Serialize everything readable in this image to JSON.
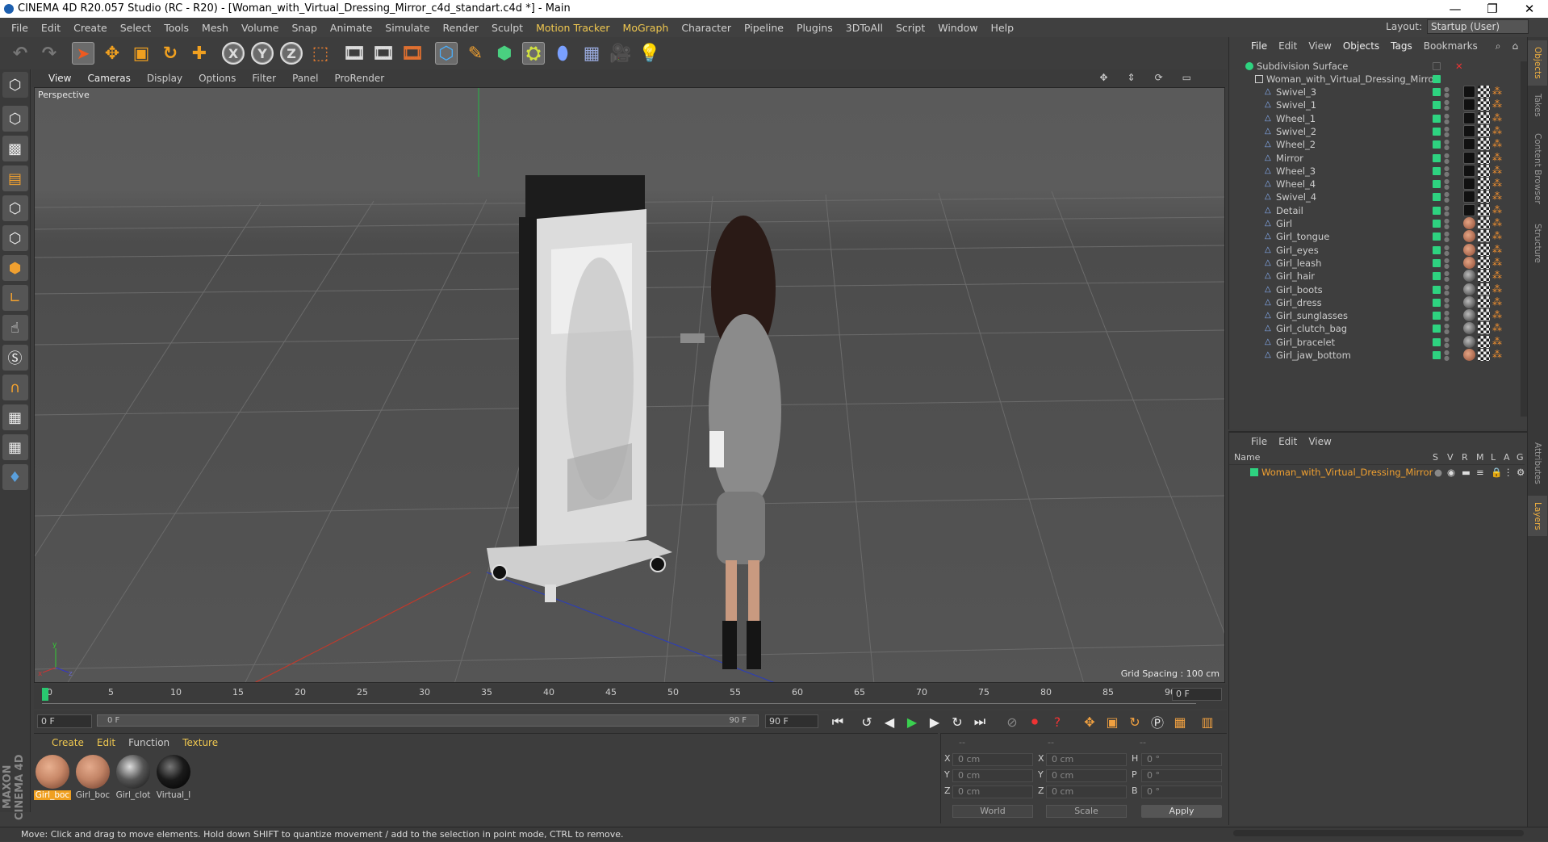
{
  "titlebar": {
    "title": "CINEMA 4D R20.057 Studio (RC - R20) - [Woman_with_Virtual_Dressing_Mirror_c4d_standart.c4d *] - Main",
    "minimize": "—",
    "maximize": "❐",
    "close": "✕"
  },
  "menubar": {
    "items": [
      "File",
      "Edit",
      "Create",
      "Select",
      "Tools",
      "Mesh",
      "Volume",
      "Snap",
      "Animate",
      "Simulate",
      "Render",
      "Sculpt",
      "Motion Tracker",
      "MoGraph",
      "Character",
      "Pipeline",
      "Plugins",
      "3DToAll",
      "Script",
      "Window",
      "Help"
    ],
    "layout_label": "Layout:",
    "layout_value": "Startup (User)"
  },
  "toolbar": {
    "icons": [
      "undo-icon",
      "redo-icon",
      "select-icon",
      "move-icon",
      "scale-icon",
      "rotate-icon",
      "add-icon",
      "x-axis-icon",
      "y-axis-icon",
      "z-axis-icon",
      "coord-system-icon",
      "render-view-icon",
      "render-icon",
      "render-settings-icon",
      "cube-icon",
      "pen-icon",
      "subdivision-icon",
      "cloner-icon",
      "deformer-icon",
      "floor-icon",
      "camera-icon",
      "light-icon"
    ],
    "axis_x": "X",
    "axis_y": "Y",
    "axis_z": "Z"
  },
  "viewport": {
    "menu": [
      "View",
      "Cameras",
      "Display",
      "Options",
      "Filter",
      "Panel",
      "ProRender"
    ],
    "label": "Perspective",
    "grid_spacing": "Grid Spacing : 100 cm",
    "nav_icons": [
      "move-view-icon",
      "zoom-view-icon",
      "rotate-view-icon",
      "maximize-view-icon"
    ],
    "axis_gizmo": {
      "x": "x",
      "y": "y",
      "z": "z"
    }
  },
  "timeline": {
    "ticks": [
      "0",
      "5",
      "10",
      "15",
      "20",
      "25",
      "30",
      "35",
      "40",
      "45",
      "50",
      "55",
      "60",
      "65",
      "70",
      "75",
      "80",
      "85",
      "90"
    ],
    "current_frame": 0,
    "end_field": "0 F",
    "start_field": "0 F",
    "range_start": "0 F",
    "range_end": "90 F",
    "max_field": "90 F"
  },
  "materials": {
    "menu": [
      "Create",
      "Edit",
      "Function",
      "Texture"
    ],
    "items": [
      {
        "name": "Girl_boc",
        "color": "#c88868",
        "selected": true
      },
      {
        "name": "Girl_boc",
        "color": "#c28466",
        "selected": false
      },
      {
        "name": "Girl_clot",
        "color": "#555555",
        "selected": false
      },
      {
        "name": "Virtual_l",
        "color": "#1a1a1a",
        "selected": false
      }
    ]
  },
  "coordinates": {
    "header": [
      "--",
      "--",
      "--"
    ],
    "rows": [
      {
        "a": "X",
        "av": "0 cm",
        "b": "X",
        "bv": "0 cm",
        "c": "H",
        "cv": "0 °"
      },
      {
        "a": "Y",
        "av": "0 cm",
        "b": "Y",
        "bv": "0 cm",
        "c": "P",
        "cv": "0 °"
      },
      {
        "a": "Z",
        "av": "0 cm",
        "b": "Z",
        "bv": "0 cm",
        "c": "B",
        "cv": "0 °"
      }
    ],
    "mode": "World",
    "type": "Scale",
    "apply": "Apply"
  },
  "object_manager": {
    "menu": [
      "File",
      "Edit",
      "View",
      "Objects",
      "Tags",
      "Bookmarks"
    ],
    "root": "Subdivision Surface",
    "group": "Woman_with_Virtual_Dressing_Mirror",
    "objects": [
      {
        "name": "Swivel_3",
        "tag": "blk"
      },
      {
        "name": "Swivel_1",
        "tag": "blk"
      },
      {
        "name": "Wheel_1",
        "tag": "blk"
      },
      {
        "name": "Swivel_2",
        "tag": "blk"
      },
      {
        "name": "Wheel_2",
        "tag": "blk"
      },
      {
        "name": "Mirror",
        "tag": "blk"
      },
      {
        "name": "Wheel_3",
        "tag": "blk"
      },
      {
        "name": "Wheel_4",
        "tag": "blk"
      },
      {
        "name": "Swivel_4",
        "tag": "blk"
      },
      {
        "name": "Detail",
        "tag": "blk"
      },
      {
        "name": "Girl",
        "tag": "skin"
      },
      {
        "name": "Girl_tongue",
        "tag": "skin"
      },
      {
        "name": "Girl_eyes",
        "tag": "skin"
      },
      {
        "name": "Girl_leash",
        "tag": "skin"
      },
      {
        "name": "Girl_hair",
        "tag": "gry"
      },
      {
        "name": "Girl_boots",
        "tag": "gry"
      },
      {
        "name": "Girl_dress",
        "tag": "gry"
      },
      {
        "name": "Girl_sunglasses",
        "tag": "gry"
      },
      {
        "name": "Girl_clutch_bag",
        "tag": "gry"
      },
      {
        "name": "Girl_bracelet",
        "tag": "gry"
      },
      {
        "name": "Girl_jaw_bottom",
        "tag": "skin"
      }
    ]
  },
  "layer_manager": {
    "menu": [
      "File",
      "Edit",
      "View"
    ],
    "columns": {
      "name": "Name",
      "s": "S",
      "v": "V",
      "r": "R",
      "m": "M",
      "l": "L",
      "a": "A",
      "g": "G"
    },
    "layer": "Woman_with_Virtual_Dressing_Mirror"
  },
  "right_tabs": [
    "Objects",
    "Takes",
    "Content Browser",
    "Structure",
    "Attributes",
    "Layers"
  ],
  "status": "Move: Click and drag to move elements. Hold down SHIFT to quantize movement / add to the selection in point mode, CTRL to remove.",
  "brand": "MAXON CINEMA 4D",
  "colors": {
    "accent": "#f0c850",
    "green": "#2ed380",
    "orange": "#f0a030"
  }
}
